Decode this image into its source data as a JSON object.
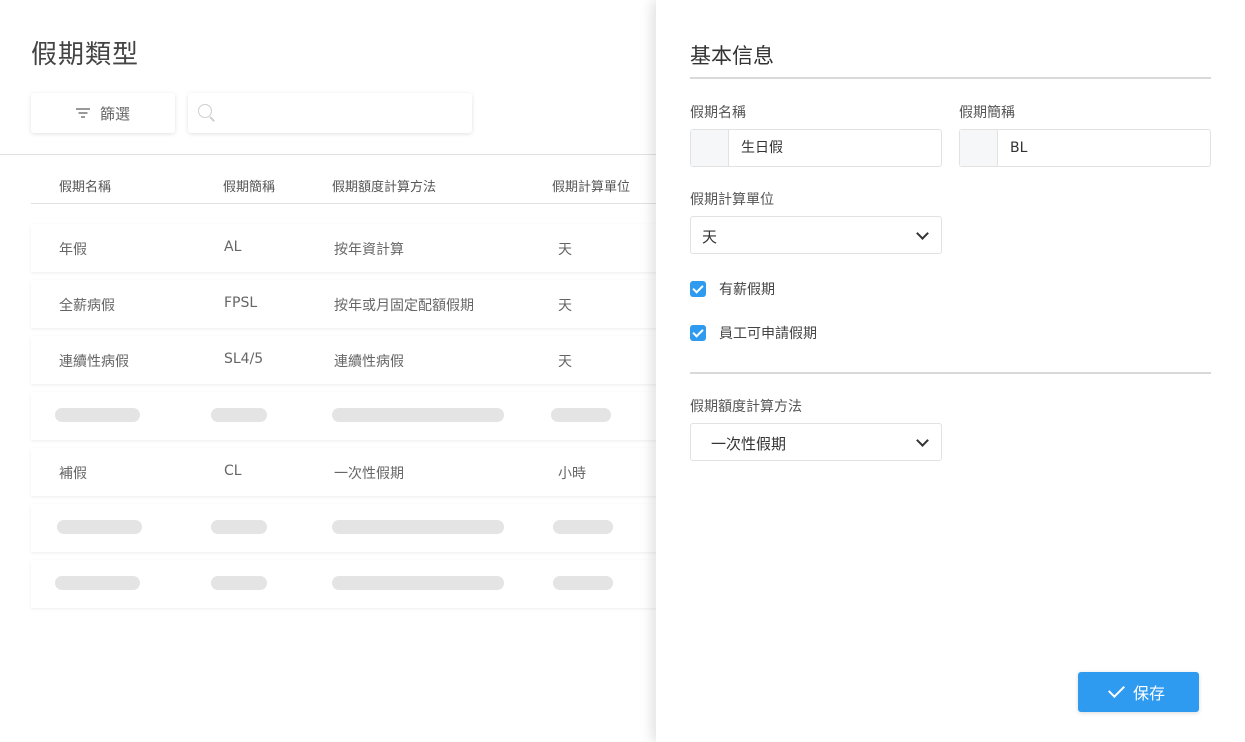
{
  "page": {
    "title": "假期類型",
    "filter_label": "篩選",
    "search_placeholder": ""
  },
  "table": {
    "headers": [
      "假期名稱",
      "假期簡稱",
      "假期額度計算方法",
      "假期計算單位"
    ],
    "rows": [
      {
        "name": "年假",
        "abbr": "AL",
        "method": "按年資計算",
        "unit": "天"
      },
      {
        "name": "全薪病假",
        "abbr": "FPSL",
        "method": "按年或月固定配額假期",
        "unit": "天"
      },
      {
        "name": "連續性病假",
        "abbr": "SL4/5",
        "method": "連續性病假",
        "unit": "天"
      },
      {
        "loading": true
      },
      {
        "name": "補假",
        "abbr": "CL",
        "method": "一次性假期",
        "unit": "小時"
      },
      {
        "loading": true
      },
      {
        "loading": true
      }
    ]
  },
  "panel": {
    "title": "基本信息",
    "name_label": "假期名稱",
    "name_value": "生日假",
    "abbr_label": "假期簡稱",
    "abbr_value": "BL",
    "unit_label": "假期計算單位",
    "unit_value": "天",
    "paid_label": "有薪假期",
    "paid_checked": true,
    "apply_label": "員工可申請假期",
    "apply_checked": true,
    "method_label": "假期額度計算方法",
    "method_value": "一次性假期",
    "save_label": "保存"
  },
  "colors": {
    "accent": "#2e9bf0",
    "skeleton": "#e4e4e4"
  }
}
